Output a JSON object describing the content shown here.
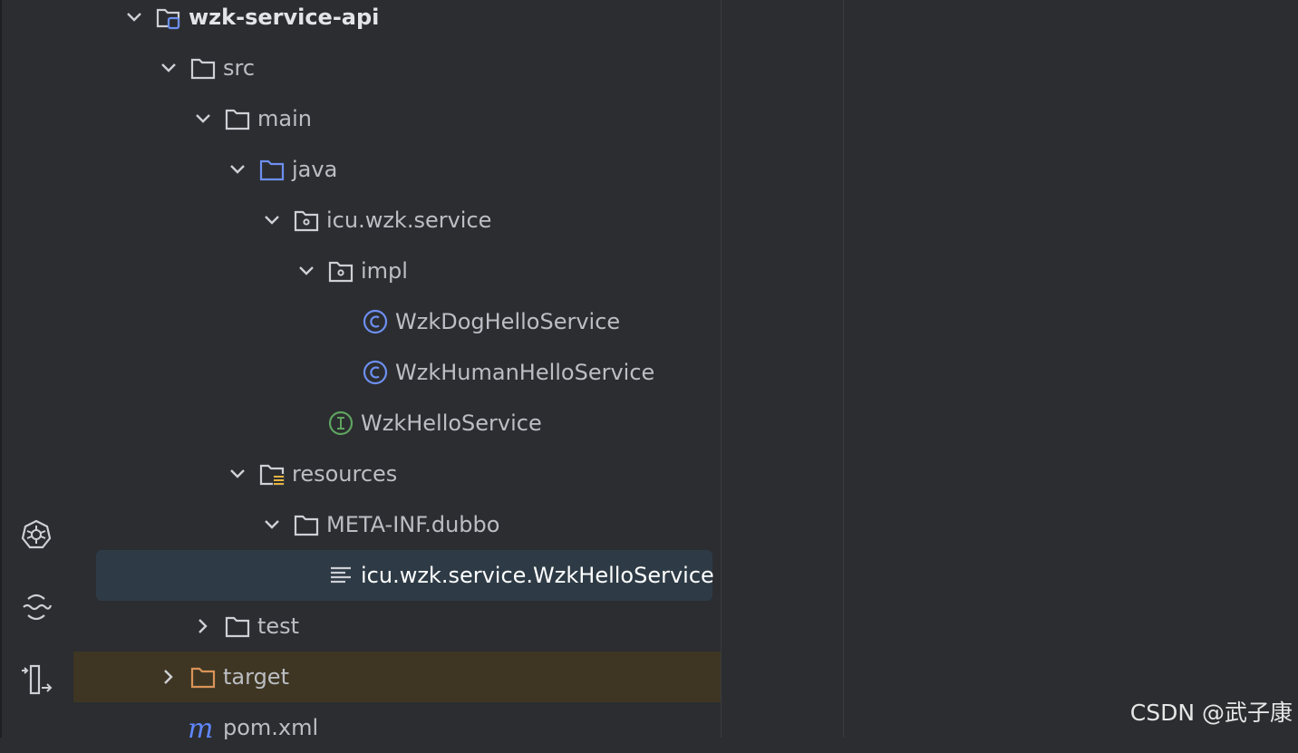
{
  "toolbar": {
    "icons": [
      "kubernetes-icon",
      "sync-wave-icon",
      "structure-arrow-icon"
    ]
  },
  "tree": {
    "nodes": [
      {
        "label": "wzk-service-api",
        "icon": "module-folder-icon",
        "expanded": true
      },
      {
        "label": "src",
        "icon": "folder-icon",
        "expanded": true
      },
      {
        "label": "main",
        "icon": "folder-icon",
        "expanded": true
      },
      {
        "label": "java",
        "icon": "source-root-folder-icon",
        "expanded": true
      },
      {
        "label": "icu.wzk.service",
        "icon": "package-icon",
        "expanded": true
      },
      {
        "label": "impl",
        "icon": "package-icon",
        "expanded": true
      },
      {
        "label": "WzkDogHelloService",
        "icon": "class-icon"
      },
      {
        "label": "WzkHumanHelloService",
        "icon": "class-icon"
      },
      {
        "label": "WzkHelloService",
        "icon": "interface-icon"
      },
      {
        "label": "resources",
        "icon": "resources-folder-icon",
        "expanded": true
      },
      {
        "label": "META-INF.dubbo",
        "icon": "folder-icon",
        "expanded": true
      },
      {
        "label": "icu.wzk.service.WzkHelloService",
        "icon": "text-file-icon",
        "selected": true
      },
      {
        "label": "test",
        "icon": "folder-icon",
        "expanded": false
      },
      {
        "label": "target",
        "icon": "excluded-folder-icon",
        "expanded": false
      },
      {
        "label": "pom.xml",
        "icon": "maven-icon"
      }
    ]
  },
  "watermark": "CSDN @武子康",
  "colors": {
    "background": "#2b2d30",
    "selection": "#2e3b46",
    "excluded_row": "#3e3623",
    "focus_marker": "#3fae8f",
    "class_icon": "#6d8ff0",
    "interface_icon": "#5fa35f",
    "maven_icon": "#5f86ff",
    "excluded_folder": "#d99358"
  }
}
